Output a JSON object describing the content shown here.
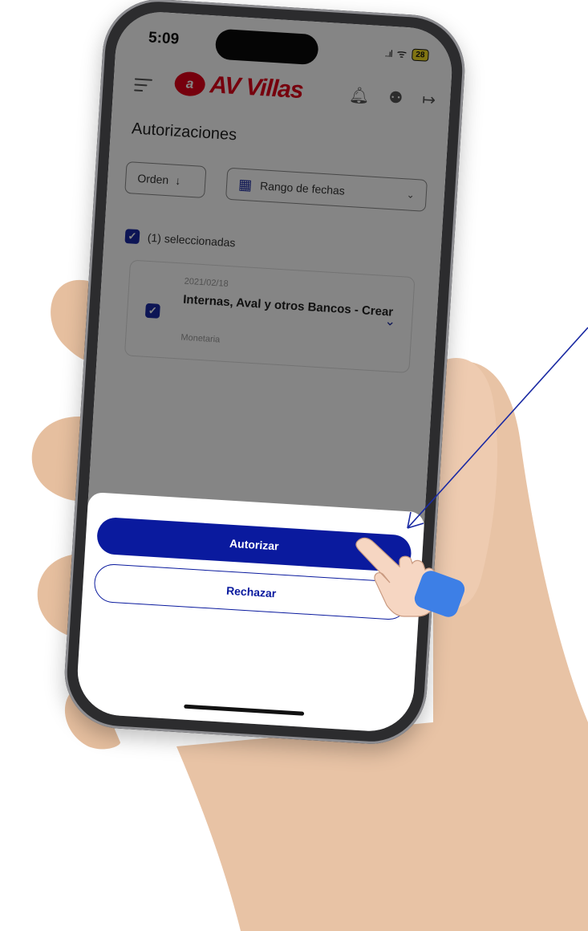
{
  "status_bar": {
    "time": "5:09",
    "signal": "..ıl",
    "wifi": "ᯤ",
    "battery": "28"
  },
  "brand": {
    "logo_mark": "a",
    "name": "AV Villas",
    "color": "#e2001a"
  },
  "header": {
    "menu_icon": "menu-icon",
    "icons": [
      "bell-icon",
      "user-icon",
      "logout-icon"
    ]
  },
  "page": {
    "title": "Autorizaciones"
  },
  "filters": {
    "order_label": "Orden",
    "order_icon": "↓",
    "date_range_label": "Rango de fechas",
    "date_icon": "▦",
    "dropdown_icon": "⌄"
  },
  "selection": {
    "summary": "(1) seleccionadas",
    "check": "✓"
  },
  "items": [
    {
      "date": "2021/02/18",
      "title": "Internas, Aval y otros Bancos - Crear",
      "category": "Monetaria",
      "expand_icon": "⌄"
    }
  ],
  "sheet": {
    "authorize_label": "Autorizar",
    "reject_label": "Rechazar"
  },
  "colors": {
    "primary": "#0a1a9e",
    "overlay": "rgba(0,0,0,0.48)"
  }
}
